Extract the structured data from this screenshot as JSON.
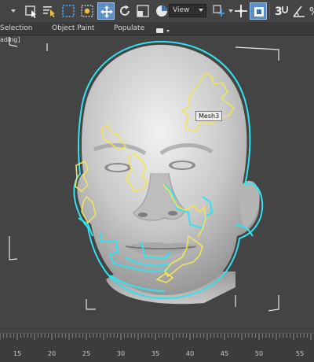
{
  "toolbar": {
    "view_dropdown": "View",
    "buttons": [
      "dropdown-arrow",
      "select-object-icon",
      "select-by-name-icon",
      "rect-select-region-icon",
      "window-crossing-icon",
      "select-and-move-icon",
      "select-and-rotate-icon",
      "select-and-scale-icon",
      "placement-icon",
      "use-pivot-icon",
      "select-and-manipulate-icon",
      "snaps-toggle-icon",
      "angle-snap-icon",
      "percent-snap-icon"
    ],
    "move_active": true,
    "manipulate_active": true,
    "snap_value": "3"
  },
  "ribbon": {
    "tabs": [
      "Selection",
      "Object Paint",
      "Populate"
    ]
  },
  "viewport": {
    "label": "ading]",
    "tooltip": "Mesh3",
    "colors": {
      "selection_outline": "#33e2ee",
      "highlight_outline": "#f2e45a",
      "skin": "#c9c9c9",
      "bounding_box": "#e6e6e6"
    }
  },
  "timeline": {
    "ticks": [
      "15",
      "20",
      "25",
      "30",
      "35",
      "40",
      "45",
      "50",
      "55"
    ]
  }
}
